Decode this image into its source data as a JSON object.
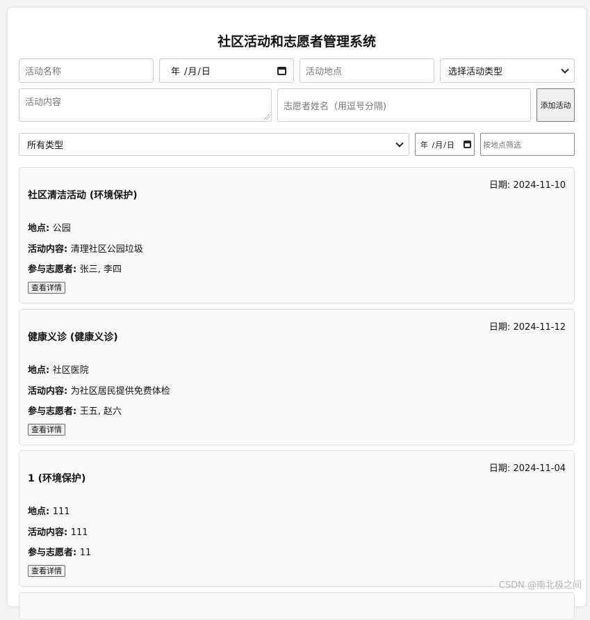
{
  "app": {
    "title": "社区活动和志愿者管理系统"
  },
  "form": {
    "name_placeholder": "活动名称",
    "date_display": "年 /月/日",
    "location_placeholder": "活动地点",
    "type_select_value": "选择活动类型",
    "content_placeholder": "活动内容",
    "volunteers_placeholder": "志愿者姓名（用逗号分隔)",
    "add_button": "添加活动"
  },
  "filters": {
    "type_value": "所有类型",
    "date_display": "年 /月/日",
    "location_placeholder": "按地点筛选"
  },
  "labels": {
    "date": "日期: ",
    "location": "地点: ",
    "content": "活动内容: ",
    "volunteers": "参与志愿者: ",
    "details_button": "查看详情"
  },
  "activities": [
    {
      "title": "社区清洁活动 (环境保护)",
      "date": "2024-11-10",
      "location": "公园",
      "content": "清理社区公园垃圾",
      "volunteers": "张三, 李四"
    },
    {
      "title": "健康义诊 (健康义诊)",
      "date": "2024-11-12",
      "location": "社区医院",
      "content": "为社区居民提供免费体检",
      "volunteers": "王五, 赵六"
    },
    {
      "title": "1 (环境保护)",
      "date": "2024-11-04",
      "location": "111",
      "content": "111",
      "volunteers": "11"
    }
  ],
  "watermark": "CSDN @南北极之间"
}
